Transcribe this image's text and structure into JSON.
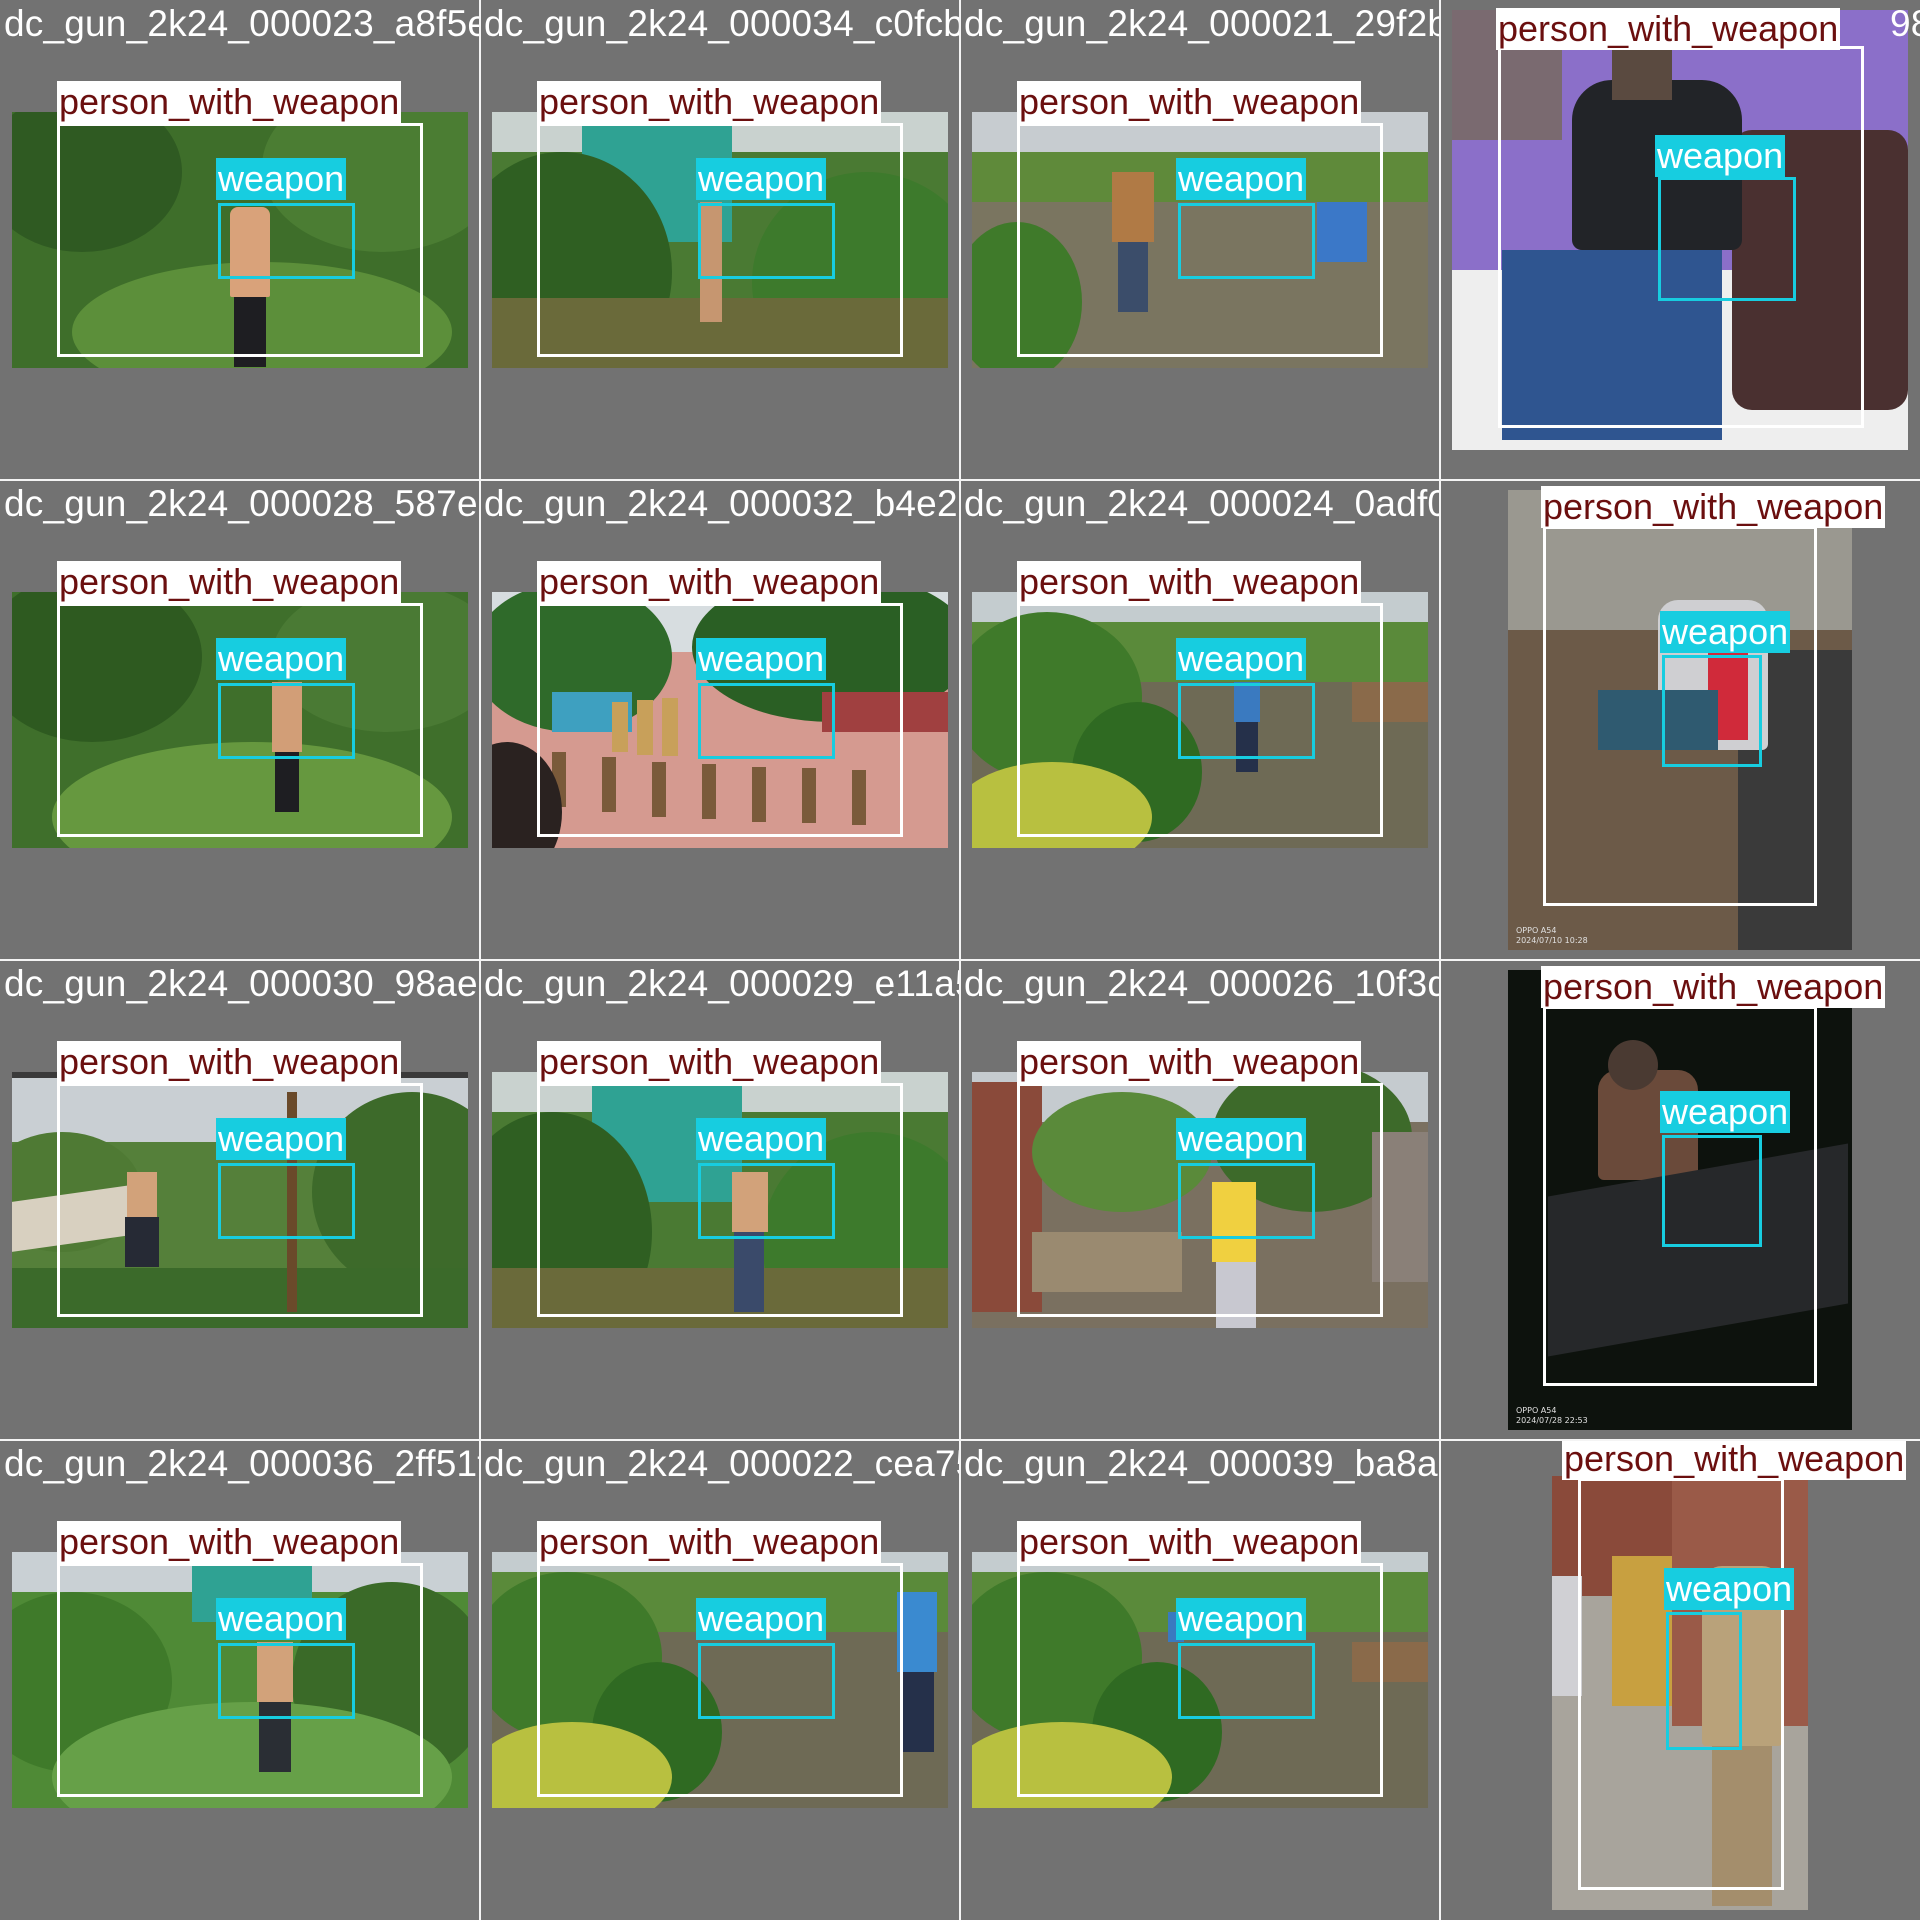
{
  "classes": {
    "person": "person_with_weapon",
    "weapon": "weapon"
  },
  "colors": {
    "person_box": "#ffffff",
    "person_label_text": "#6b0f0f",
    "weapon_box": "#17cde0",
    "background": "#727272"
  },
  "tiles": [
    {
      "filename": "dc_gun_2k24_000023_a8f5edbae.jpg"
    },
    {
      "filename": "dc_gun_2k24_000034_c0fcbbd4.jpg"
    },
    {
      "filename": "dc_gun_2k24_000021_29f2bd1"
    },
    {
      "filename": "98"
    },
    {
      "filename": "dc_gun_2k24_000028_587edb21.jpg"
    },
    {
      "filename": "dc_gun_2k24_000032_b4e2de70.jpg"
    },
    {
      "filename": "dc_gun_2k24_000024_0adf02d3.jpg"
    },
    {
      "filename": ""
    },
    {
      "filename": "dc_gun_2k24_000030_98aed36b.jpg"
    },
    {
      "filename": "dc_gun_2k24_000029_e11a5440.jpg"
    },
    {
      "filename": "dc_gun_2k24_000026_10f3da57.jpg"
    },
    {
      "filename": ""
    },
    {
      "filename": "dc_gun_2k24_000036_2ff51f98.jpg"
    },
    {
      "filename": "dc_gun_2k24_000022_cea752e9.jpg"
    },
    {
      "filename": "dc_gun_2k24_000039_ba8a2ea9.jpg"
    },
    {
      "filename": ""
    }
  ],
  "stamps": {
    "tile8": "OPPO A54\n2024/07/10 10:28",
    "tile12": "OPPO A54\n2024/07/28 22:53"
  }
}
